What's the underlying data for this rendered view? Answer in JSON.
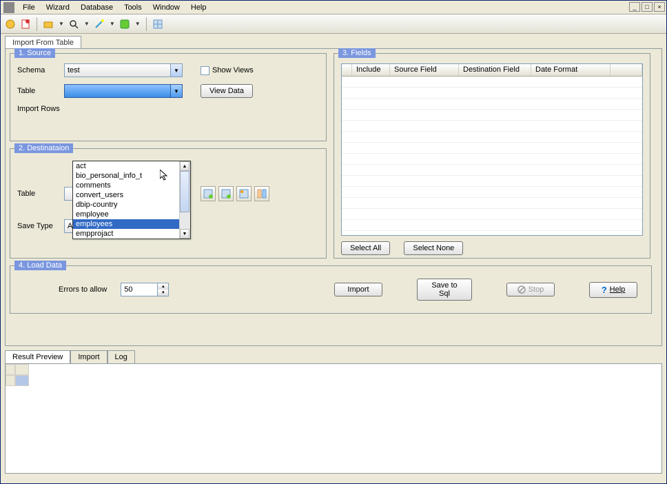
{
  "menu": {
    "items": [
      "File",
      "Wizard",
      "Database",
      "Tools",
      "Window",
      "Help"
    ]
  },
  "main_tab": {
    "label": "Import From Table"
  },
  "source": {
    "legend": "1. Source",
    "schema_label": "Schema",
    "schema_value": "test",
    "table_label": "Table",
    "table_value": "",
    "import_rows_label": "Import Rows",
    "show_views_label": "Show Views",
    "view_data_btn": "View Data",
    "dropdown_items": [
      "act",
      "bio_personal_info_t",
      "comments",
      "convert_users",
      "dbip-country",
      "employee",
      "employees",
      "empprojact"
    ],
    "dropdown_highlight": "employees"
  },
  "destination": {
    "legend": "2. Destinataion",
    "table_label": "Table",
    "table_value": "",
    "save_type_label": "Save Type",
    "save_type_value": "Append"
  },
  "fields": {
    "legend": "3. Fields",
    "cols": [
      "Include",
      "Source Field",
      "Destination Field",
      "Date Format"
    ],
    "select_all_btn": "Select All",
    "select_none_btn": "Select None"
  },
  "load": {
    "legend": "4. Load Data",
    "errors_label": "Errors to allow",
    "errors_value": "50",
    "import_btn": "Import",
    "save_sql_btn": "Save to Sql",
    "stop_btn": "Stop",
    "help_btn": "Help"
  },
  "result_tabs": [
    "Result Preview",
    "Import",
    "Log"
  ]
}
